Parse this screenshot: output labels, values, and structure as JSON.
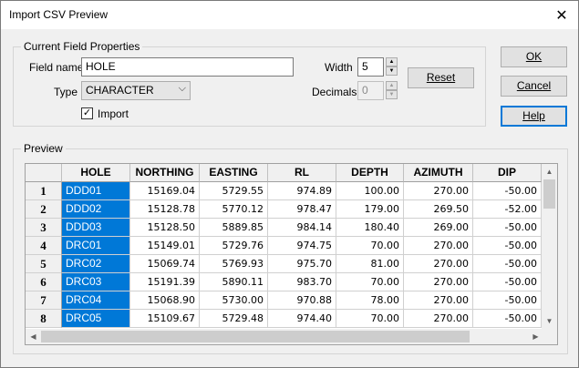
{
  "window": {
    "title": "Import CSV Preview",
    "close_glyph": "✕"
  },
  "field_properties": {
    "legend": "Current Field Properties",
    "field_name_label": "Field name",
    "field_name_value": "HOLE",
    "type_label": "Type",
    "type_value": "CHARACTER",
    "width_label": "Width",
    "width_value": "5",
    "decimals_label": "Decimals",
    "decimals_value": "0",
    "import_label": "Import",
    "import_checked": true,
    "reset_label": "Reset"
  },
  "buttons": {
    "ok": "OK",
    "cancel": "Cancel",
    "help": "Help"
  },
  "preview": {
    "legend": "Preview",
    "columns": [
      "HOLE",
      "NORTHING",
      "EASTING",
      "RL",
      "DEPTH",
      "AZIMUTH",
      "DIP"
    ],
    "rows": [
      {
        "n": "1",
        "cells": [
          "DDD01",
          "15169.04",
          "5729.55",
          "974.89",
          "100.00",
          "270.00",
          "-50.00"
        ]
      },
      {
        "n": "2",
        "cells": [
          "DDD02",
          "15128.78",
          "5770.12",
          "978.47",
          "179.00",
          "269.50",
          "-52.00"
        ]
      },
      {
        "n": "3",
        "cells": [
          "DDD03",
          "15128.50",
          "5889.85",
          "984.14",
          "180.40",
          "269.00",
          "-50.00"
        ]
      },
      {
        "n": "4",
        "cells": [
          "DRC01",
          "15149.01",
          "5729.76",
          "974.75",
          "70.00",
          "270.00",
          "-50.00"
        ]
      },
      {
        "n": "5",
        "cells": [
          "DRC02",
          "15069.74",
          "5769.93",
          "975.70",
          "81.00",
          "270.00",
          "-50.00"
        ]
      },
      {
        "n": "6",
        "cells": [
          "DRC03",
          "15191.39",
          "5890.11",
          "983.70",
          "70.00",
          "270.00",
          "-50.00"
        ]
      },
      {
        "n": "7",
        "cells": [
          "DRC04",
          "15068.90",
          "5730.00",
          "970.88",
          "78.00",
          "270.00",
          "-50.00"
        ]
      },
      {
        "n": "8",
        "cells": [
          "DRC05",
          "15109.67",
          "5729.48",
          "974.40",
          "70.00",
          "270.00",
          "-50.00"
        ]
      }
    ]
  },
  "colors": {
    "selection": "#0078d7",
    "focus": "#0078d7"
  }
}
